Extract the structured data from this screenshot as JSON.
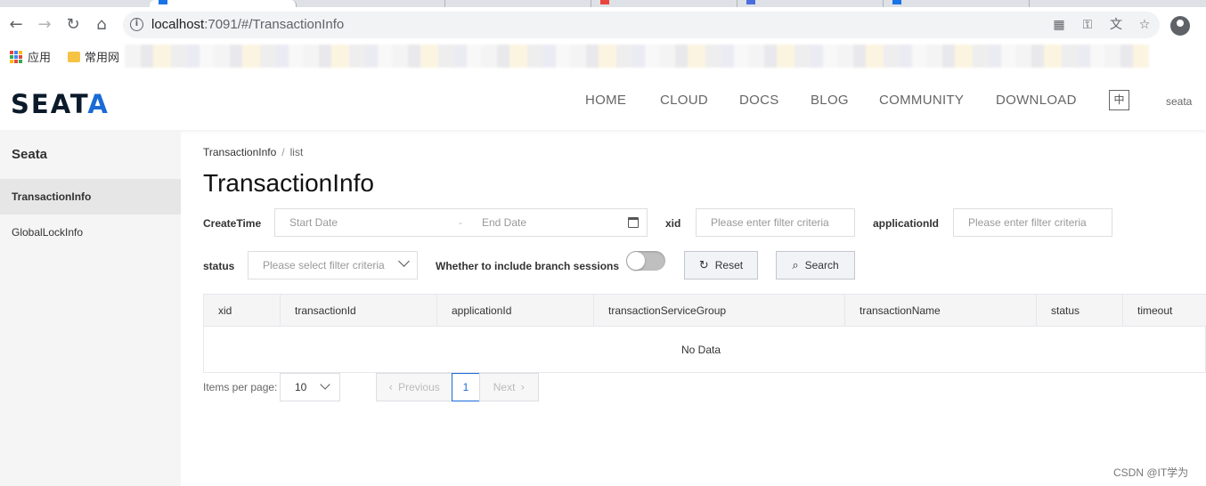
{
  "browser": {
    "url_host": "localhost",
    "url_rest": ":7091/#/TransactionInfo",
    "bookmarks": {
      "apps_label": "应用",
      "folder_label": "常用网"
    }
  },
  "header": {
    "logo": "SEATA",
    "nav": [
      "HOME",
      "CLOUD",
      "DOCS",
      "BLOG",
      "COMMUNITY",
      "DOWNLOAD"
    ],
    "lang_button": "中",
    "user": "seata"
  },
  "sidebar": {
    "title": "Seata",
    "items": [
      {
        "label": "TransactionInfo",
        "active": true
      },
      {
        "label": "GlobalLockInfo",
        "active": false
      }
    ]
  },
  "breadcrumb": {
    "parent": "TransactionInfo",
    "separator": "/",
    "current": "list"
  },
  "page_title": "TransactionInfo",
  "filters": {
    "create_time_label": "CreateTime",
    "start_date_placeholder": "Start Date",
    "date_separator": "-",
    "end_date_placeholder": "End Date",
    "xid_label": "xid",
    "xid_placeholder": "Please enter filter criteria",
    "application_id_label": "applicationId",
    "application_id_placeholder": "Please enter filter criteria",
    "status_label": "status",
    "status_placeholder": "Please select filter criteria",
    "branch_label": "Whether to include branch sessions",
    "branch_toggle_on": false,
    "reset_label": "Reset",
    "search_label": "Search"
  },
  "table": {
    "columns": [
      "xid",
      "transactionId",
      "applicationId",
      "transactionServiceGroup",
      "transactionName",
      "status",
      "timeout"
    ],
    "empty_text": "No Data"
  },
  "pagination": {
    "items_per_page_label": "Items per page:",
    "page_size": "10",
    "previous_label": "Previous",
    "next_label": "Next",
    "current_page": "1"
  },
  "watermark": "CSDN @IT学为"
}
